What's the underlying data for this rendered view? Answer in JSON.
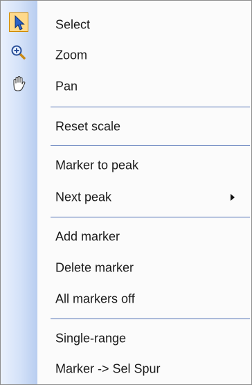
{
  "menu": {
    "items": [
      {
        "label": "Select",
        "icon": "arrow-pointer-icon",
        "checked": true
      },
      {
        "label": "Zoom",
        "icon": "zoom-in-icon"
      },
      {
        "label": "Pan",
        "icon": "hand-pan-icon"
      },
      {
        "label": "Reset scale"
      },
      {
        "label": "Marker to peak"
      },
      {
        "label": "Next peak",
        "submenu": true
      },
      {
        "label": "Add marker"
      },
      {
        "label": "Delete marker"
      },
      {
        "label": "All markers off"
      },
      {
        "label": "Single-range"
      },
      {
        "label": "Marker -> Sel Spur"
      }
    ]
  }
}
